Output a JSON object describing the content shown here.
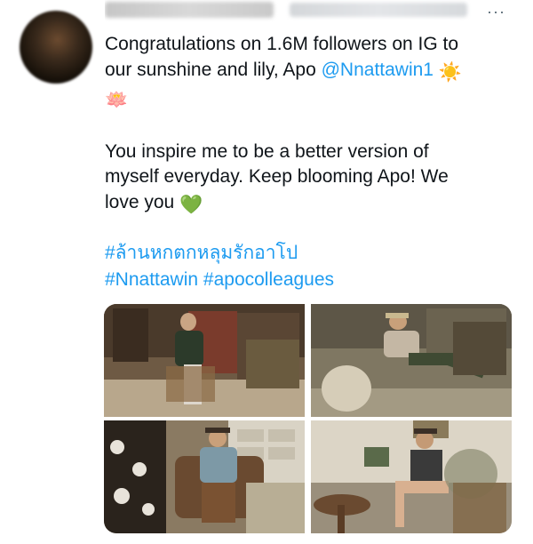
{
  "tweet": {
    "body": {
      "line1": "Congratulations on 1.6M followers on IG to",
      "line2_prefix": "our sunshine and lily, Apo ",
      "mention": "@Nnattawin1",
      "sun_emoji": "☀️",
      "lotus_emoji": "🪷",
      "para2_line1": "You inspire me to be a better version of",
      "para2_line2": "myself everyday. Keep blooming Apo! We",
      "para2_line3": "love you",
      "heart_emoji": "💚"
    },
    "hashtags": {
      "thai": "#ล้านหกตกหลุมรักอาโป",
      "tag2": "#Nnattawin",
      "tag3": "#apocolleagues"
    },
    "more_icon": "more-horizontal-icon"
  },
  "colors": {
    "link": "#1d9bf0",
    "text": "#0f1419",
    "muted": "#536471"
  },
  "media": [
    {
      "id": "photo-1",
      "desc": "man seated in wooden chair in antique shop"
    },
    {
      "id": "photo-2",
      "desc": "man in cap reclining in chair among antiques"
    },
    {
      "id": "photo-3",
      "desc": "man in hat seated in leather armchair near china cabinet"
    },
    {
      "id": "photo-4",
      "desc": "man in hat seated by round table with plants"
    }
  ]
}
